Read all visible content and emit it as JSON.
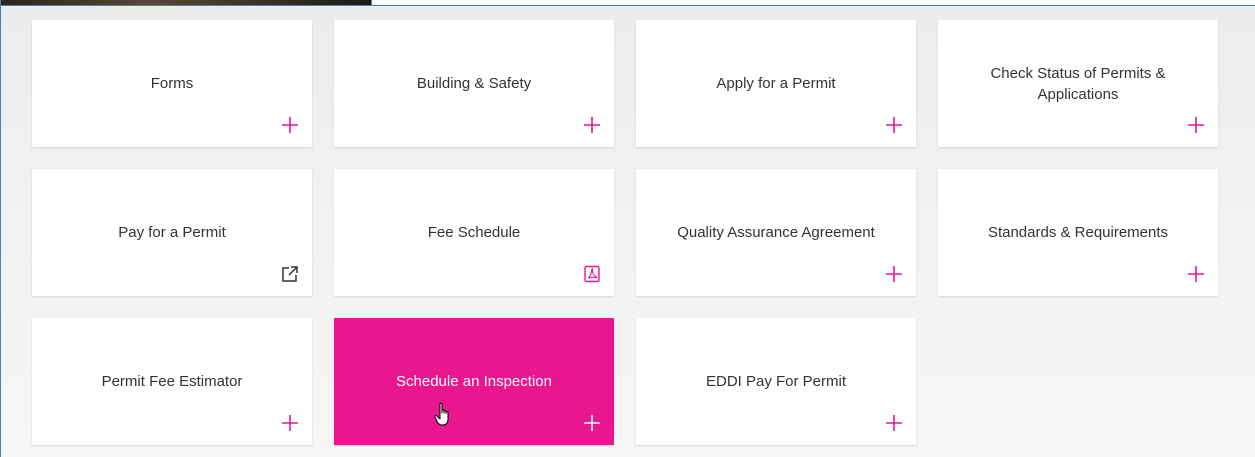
{
  "colors": {
    "accent": "#e8168f",
    "text": "#333333",
    "frame_border": "#4a7fc0"
  },
  "tiles": [
    {
      "label": "Forms",
      "icon": "plus-icon"
    },
    {
      "label": "Building & Safety",
      "icon": "plus-icon"
    },
    {
      "label": "Apply for a Permit",
      "icon": "plus-icon"
    },
    {
      "label": "Check Status of Permits & Applications",
      "icon": "plus-icon"
    },
    {
      "label": "Pay for a Permit",
      "icon": "external-link-icon"
    },
    {
      "label": "Fee Schedule",
      "icon": "pdf-icon"
    },
    {
      "label": "Quality Assurance Agreement",
      "icon": "plus-icon"
    },
    {
      "label": "Standards & Requirements",
      "icon": "plus-icon"
    },
    {
      "label": "Permit Fee Estimator",
      "icon": "plus-icon"
    },
    {
      "label": "Schedule an Inspection",
      "icon": "plus-icon",
      "state": "hovered"
    },
    {
      "label": "EDDI Pay For Permit",
      "icon": "plus-icon"
    }
  ]
}
